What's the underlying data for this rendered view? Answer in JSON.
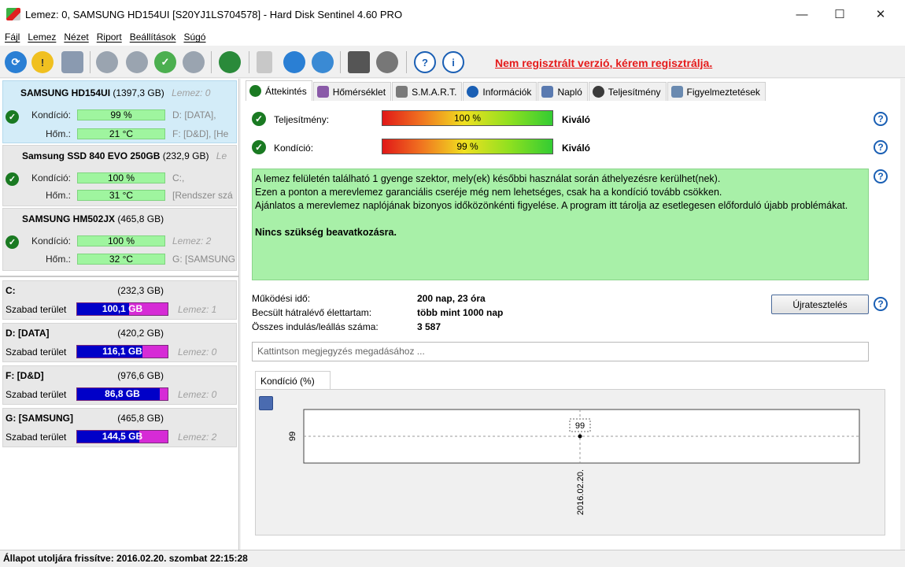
{
  "window": {
    "title": "Lemez: 0, SAMSUNG HD154UI [S20YJ1LS704578]  -  Hard Disk Sentinel 4.60 PRO",
    "minimize": "—",
    "maximize": "☐",
    "close": "✕"
  },
  "menu": [
    "Fájl",
    "Lemez",
    "Nézet",
    "Riport",
    "Beállítások",
    "Súgó"
  ],
  "toolbar": {
    "icons": [
      "refresh-icon",
      "warning-icon",
      "drive-icon",
      "disk-test-icon",
      "disk-test-icon",
      "disk-test-ok-icon",
      "disk-test-icon",
      "globe-icon",
      "report-icon",
      "copy-icon",
      "network-icon",
      "monitor-icon",
      "speaker-icon",
      "help-icon",
      "info-icon"
    ],
    "notice": "Nem regisztrált verzió, kérem regisztrálja."
  },
  "disks": [
    {
      "name": "SAMSUNG HD154UI",
      "size": "(1397,3 GB)",
      "lemez": "Lemez: 0",
      "kondicio_label": "Kondíció:",
      "kondicio": "99 %",
      "kondicio_pct": 99,
      "hom_label": "Hőm.:",
      "hom": "21 °C",
      "right1": "D: [DATA],",
      "right2": "F: [D&D],  [He"
    },
    {
      "name": "Samsung SSD 840 EVO 250GB",
      "size": "(232,9 GB)",
      "lemez": "Le",
      "kondicio_label": "Kondíció:",
      "kondicio": "100 %",
      "kondicio_pct": 100,
      "hom_label": "Hőm.:",
      "hom": "31 °C",
      "right1": "C:,",
      "right2": "[Rendszer szá"
    },
    {
      "name": "SAMSUNG HM502JX",
      "size": "(465,8 GB)",
      "lemez": "",
      "kondicio_label": "Kondíció:",
      "kondicio": "100 %",
      "kondicio_pct": 100,
      "hom_label": "Hőm.:",
      "hom": "32 °C",
      "right1": "Lemez: 2",
      "right2": "G: [SAMSUNG"
    }
  ],
  "volumes": [
    {
      "name": "C:",
      "size": "(232,3 GB)",
      "free_label": "Szabad terület",
      "free": "100,1 GB",
      "used_pct": 57,
      "lemez": "Lemez: 1"
    },
    {
      "name": "D: [DATA]",
      "size": "(420,2 GB)",
      "free_label": "Szabad terület",
      "free": "116,1 GB",
      "used_pct": 72,
      "lemez": "Lemez: 0"
    },
    {
      "name": "F: [D&D]",
      "size": "(976,6 GB)",
      "free_label": "Szabad terület",
      "free": "86,8 GB",
      "used_pct": 91,
      "lemez": "Lemez: 0"
    },
    {
      "name": "G: [SAMSUNG]",
      "size": "(465,8 GB)",
      "free_label": "Szabad terület",
      "free": "144,5 GB",
      "used_pct": 69,
      "lemez": "Lemez: 2"
    }
  ],
  "tabs": [
    {
      "label": "Áttekintés",
      "icon": "check-icon",
      "color": "#1a7a22"
    },
    {
      "label": "Hőmérséklet",
      "icon": "thermometer-icon",
      "color": "#8a5aa8"
    },
    {
      "label": "S.M.A.R.T.",
      "icon": "smart-icon",
      "color": "#7a7a7a"
    },
    {
      "label": "Információk",
      "icon": "info-icon",
      "color": "#1a5fb4"
    },
    {
      "label": "Napló",
      "icon": "log-icon",
      "color": "#5a7ab0"
    },
    {
      "label": "Teljesítmény",
      "icon": "speedometer-icon",
      "color": "#3a3a3a"
    },
    {
      "label": "Figyelmeztetések",
      "icon": "alerts-icon",
      "color": "#6a8ab0"
    }
  ],
  "overview": {
    "performance": {
      "label": "Teljesítmény:",
      "value": "100 %",
      "pct": 100,
      "rating": "Kiváló"
    },
    "condition": {
      "label": "Kondíció:",
      "value": "99 %",
      "pct": 99,
      "rating": "Kiváló"
    },
    "message_lines": [
      "A lemez felületén található 1 gyenge szektor, mely(ek) későbbi használat során áthelyezésre kerülhet(nek).",
      "Ezen a ponton a merevlemez garanciális cseréje még nem lehetséges, csak ha a kondíció tovább csökken.",
      "Ajánlatos a merevlemez naplójának bizonyos időközönkénti figyelése. A program itt tárolja az esetlegesen előforduló újabb problémákat."
    ],
    "message_bold": "Nincs szükség beavatkozásra.",
    "uptime_label": "Működési idő:",
    "uptime": "200 nap, 23 óra",
    "remaining_label": "Becsült hátralévő élettartam:",
    "remaining": "több mint 1000 nap",
    "starts_label": "Összes indulás/leállás száma:",
    "starts": "3 587",
    "retest_button": "Újratesztelés",
    "comment_placeholder": "Kattintson megjegyzés megadásához ..."
  },
  "chart_tab": "Kondíció  (%)",
  "chart_data": {
    "type": "line",
    "x": [
      "2016.02.20."
    ],
    "series": [
      {
        "values": [
          99
        ]
      }
    ],
    "ylabel": "",
    "y_tick": "99",
    "x_tick": "2016.02.20.",
    "point_label": "99",
    "grid": true
  },
  "status": "Állapot utoljára frissítve: 2016.02.20. szombat 22:15:28"
}
